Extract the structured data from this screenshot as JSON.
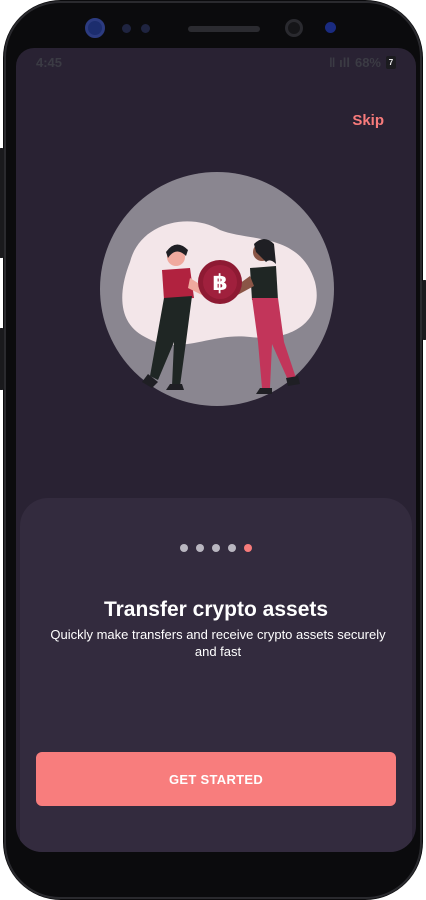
{
  "status_bar": {
    "time": "4:45",
    "signal_text": "ǁ ıll",
    "battery_percent": "68%",
    "notification_badge": "7"
  },
  "onboarding": {
    "skip_label": "Skip",
    "illustration": {
      "coin_symbol": "฿",
      "icon": "bitcoin-exchange-illustration"
    },
    "page_count": 5,
    "active_page": 5,
    "title": "Transfer crypto assets",
    "subtitle": "Quickly make transfers and receive crypto assets securely and fast",
    "cta_label": "GET STARTED"
  },
  "colors": {
    "background": "#292233",
    "card": "#332b3e",
    "accent": "#f77b7b",
    "dot_inactive": "#b9b6c0"
  }
}
